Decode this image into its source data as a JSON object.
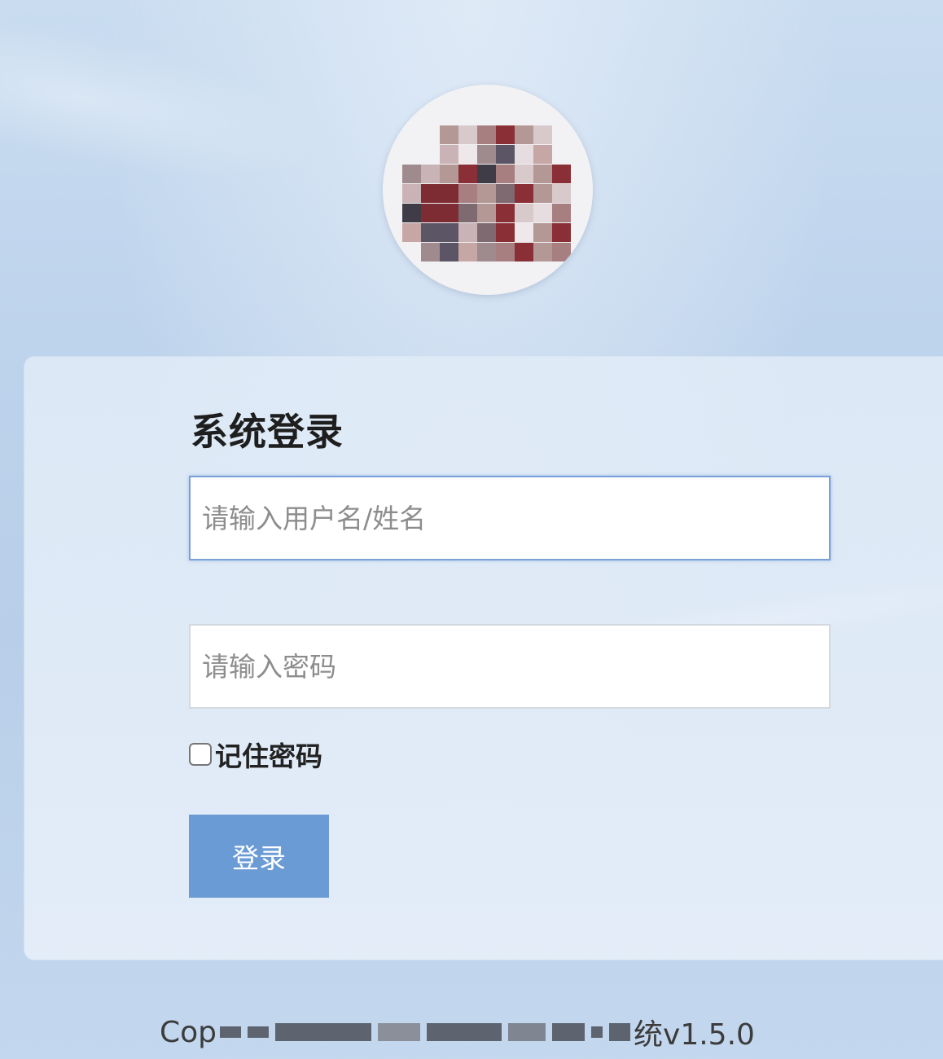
{
  "avatar": {
    "alt": "user-avatar"
  },
  "login": {
    "title": "系统登录",
    "username_placeholder": "请输入用户名/姓名",
    "username_value": "",
    "password_placeholder": "请输入密码",
    "password_value": "",
    "remember_label": "记住密码",
    "remember_checked": false,
    "submit_label": "登录"
  },
  "footer": {
    "prefix": "Cop",
    "suffix": "统v1.5.0"
  },
  "colors": {
    "button": "#6a9bd5",
    "focus_border": "#7aa2d6"
  }
}
